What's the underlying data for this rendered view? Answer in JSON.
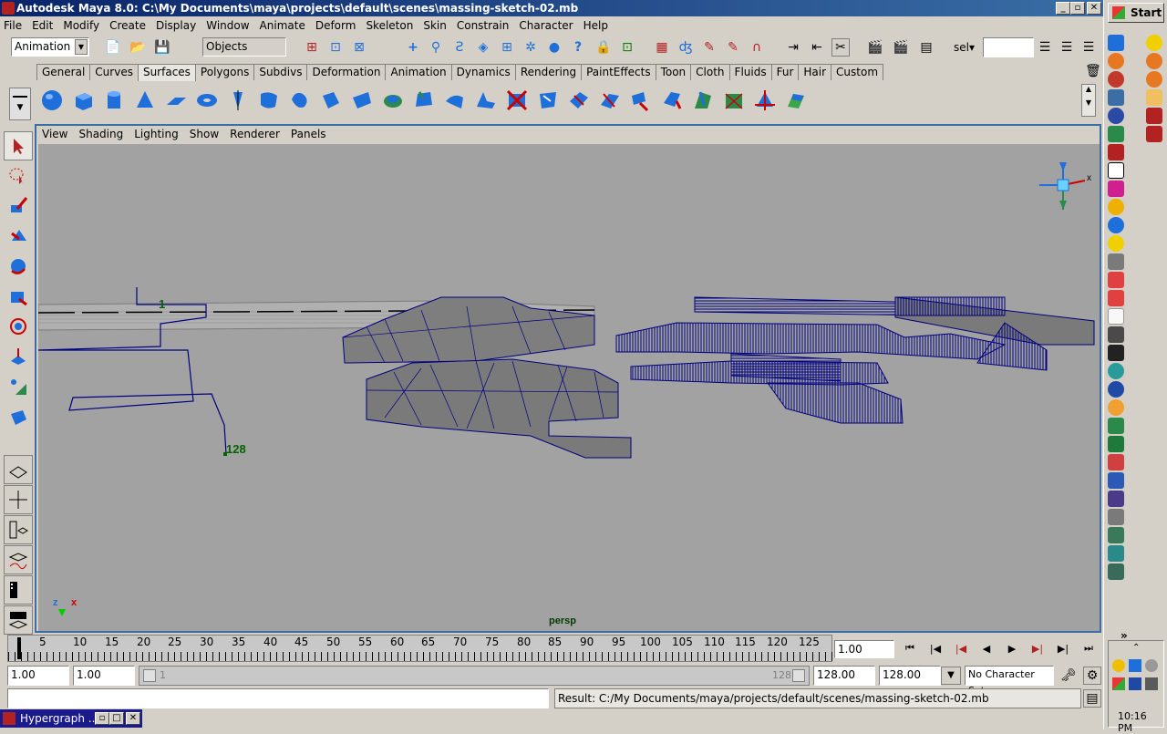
{
  "window": {
    "title": "Autodesk Maya 8.0: C:\\My Documents\\maya\\projects\\default\\scenes\\massing-sketch-02.mb",
    "min": "_",
    "max": "▫",
    "close": "✕"
  },
  "menu": [
    "File",
    "Edit",
    "Modify",
    "Create",
    "Display",
    "Window",
    "Animate",
    "Deform",
    "Skeleton",
    "Skin",
    "Constrain",
    "Character",
    "Help"
  ],
  "status_line": {
    "menu_set": "Animation",
    "selection_mode": "Objects",
    "sel_label": "sel▾",
    "sel_value": ""
  },
  "shelf": {
    "tabs": [
      "General",
      "Curves",
      "Surfaces",
      "Polygons",
      "Subdivs",
      "Deformation",
      "Animation",
      "Dynamics",
      "Rendering",
      "PaintEffects",
      "Toon",
      "Cloth",
      "Fluids",
      "Fur",
      "Hair",
      "Custom"
    ],
    "active_tab": "Surfaces"
  },
  "panel": {
    "menus": [
      "View",
      "Shading",
      "Lighting",
      "Show",
      "Renderer",
      "Panels"
    ],
    "camera_label": "persp",
    "axis_z": "z",
    "axis_x": "x",
    "path_start_label": "1",
    "path_end_label": "128"
  },
  "time_slider": {
    "ticks": [
      "5",
      "10",
      "15",
      "20",
      "25",
      "30",
      "35",
      "40",
      "45",
      "50",
      "55",
      "60",
      "65",
      "70",
      "75",
      "80",
      "85",
      "90",
      "95",
      "100",
      "105",
      "110",
      "115",
      "120",
      "125"
    ],
    "current_time": "1.00"
  },
  "range_slider": {
    "start_time": "1.00",
    "playback_start": "1.00",
    "range_left": "1",
    "range_right": "128",
    "playback_end": "128.00",
    "end_time": "128.00",
    "character_set": "No Character Set"
  },
  "command_line": {
    "input": "",
    "result": "Result: C:/My Documents/maya/projects/default/scenes/massing-sketch-02.mb"
  },
  "taskbar": {
    "start": "Start",
    "clock": "10:16 PM",
    "hypergraph_label": "Hypergraph ..."
  },
  "colors": {
    "title_start": "#0a246a",
    "title_end": "#3a6ea5",
    "viewport_bg": "#a2a2a2",
    "wire": "#000080",
    "shelf_blue": "#1e6fd9"
  }
}
